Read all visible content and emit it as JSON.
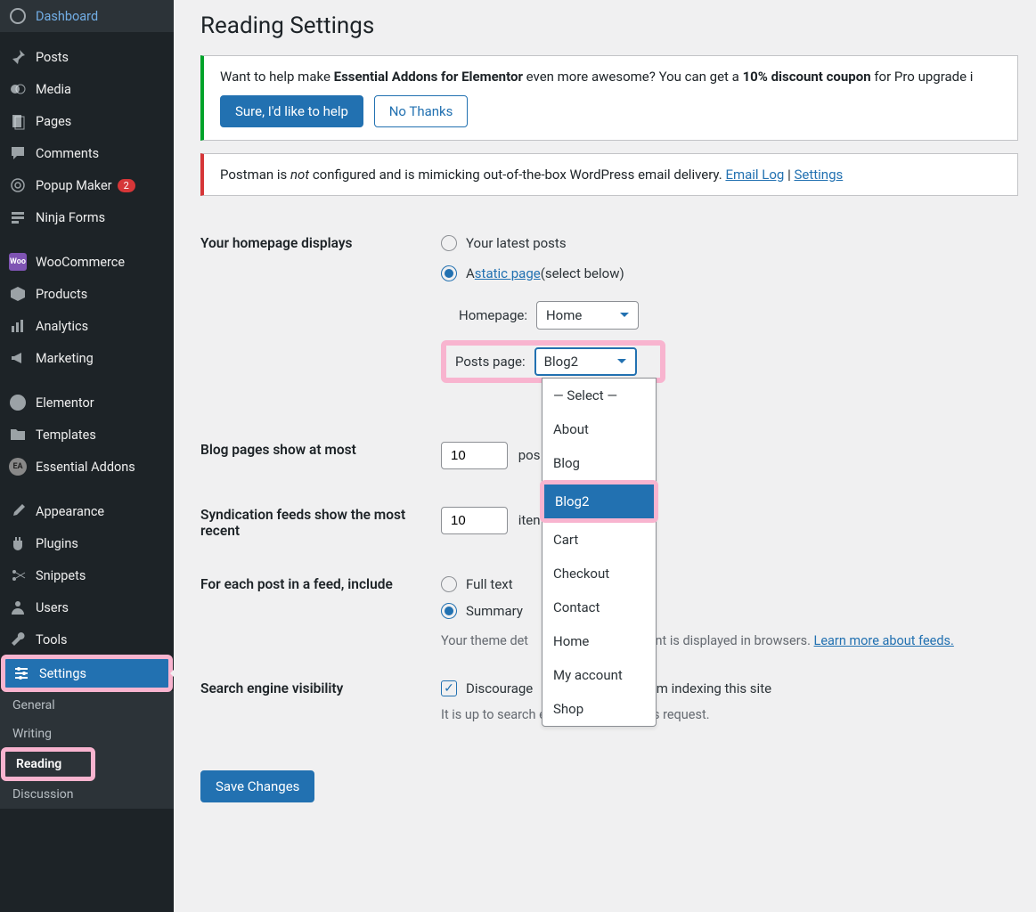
{
  "sidebar": {
    "items": [
      {
        "label": "Dashboard"
      },
      {
        "label": "Posts"
      },
      {
        "label": "Media"
      },
      {
        "label": "Pages"
      },
      {
        "label": "Comments"
      },
      {
        "label": "Popup Maker",
        "badge": "2"
      },
      {
        "label": "Ninja Forms"
      },
      {
        "label": "WooCommerce"
      },
      {
        "label": "Products"
      },
      {
        "label": "Analytics"
      },
      {
        "label": "Marketing"
      },
      {
        "label": "Elementor"
      },
      {
        "label": "Templates"
      },
      {
        "label": "Essential Addons"
      },
      {
        "label": "Appearance"
      },
      {
        "label": "Plugins"
      },
      {
        "label": "Snippets"
      },
      {
        "label": "Users"
      },
      {
        "label": "Tools"
      },
      {
        "label": "Settings"
      }
    ],
    "sub": {
      "items": [
        {
          "label": "General"
        },
        {
          "label": "Writing"
        },
        {
          "label": "Reading"
        },
        {
          "label": "Discussion"
        }
      ]
    }
  },
  "page": {
    "title": "Reading Settings"
  },
  "notice_ea": {
    "pre": "Want to help make ",
    "bold1": "Essential Addons for Elementor",
    "mid": " even more awesome? You can get a ",
    "bold2": "10% discount coupon",
    "post": " for Pro upgrade i",
    "btn_yes": "Sure, I'd like to help",
    "btn_no": "No Thanks"
  },
  "notice_pm": {
    "pre": "Postman is ",
    "em": "not",
    "post": " configured and is mimicking out-of-the-box WordPress email delivery. ",
    "link1": "Email Log",
    "sep": " | ",
    "link2": "Settings"
  },
  "form": {
    "homepage_displays": {
      "label": "Your homepage displays",
      "opt_latest": "Your latest posts",
      "opt_static_pre": "A ",
      "opt_static_link": "static page",
      "opt_static_post": " (select below)",
      "homepage_label": "Homepage:",
      "homepage_value": "Home",
      "posts_label": "Posts page:",
      "posts_value": "Blog2",
      "dropdown": [
        "— Select —",
        "About",
        "Blog",
        "Blog2",
        "Cart",
        "Checkout",
        "Contact",
        "Home",
        "My account",
        "Shop"
      ]
    },
    "blog_pages": {
      "label": "Blog pages show at most",
      "value": "10",
      "suffix": "pos"
    },
    "syndication": {
      "label": "Syndication feeds show the most recent",
      "value": "10",
      "suffix": "iten"
    },
    "feed_format": {
      "label": "For each post in a feed, include",
      "opt_full": "Full text",
      "opt_summary": "Summary",
      "help_pre": "Your theme det",
      "help_mid": "tent is displayed in browsers. ",
      "help_link": "Learn more about feeds."
    },
    "search_vis": {
      "label": "Search engine visibility",
      "checkbox_pre": "Discourage",
      "checkbox_post": "om indexing this site",
      "help": "It is up to search engines to honor this request."
    },
    "submit": "Save Changes"
  }
}
